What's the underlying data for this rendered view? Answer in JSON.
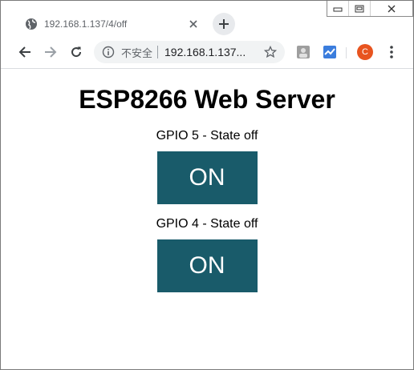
{
  "browser": {
    "tab_title": "192.168.1.137/4/off",
    "address_security": "不安全",
    "address_url": "192.168.1.137/4/off",
    "address_url_display": "192.168.1.137...",
    "avatar_letter": "C",
    "icons": {
      "tab": "globe-icon",
      "tab_close": "close-icon",
      "new_tab": "plus-icon",
      "back": "arrow-left-icon",
      "forward": "arrow-right-icon",
      "reload": "reload-icon",
      "info": "info-icon",
      "bookmark": "star-icon",
      "extension1": "puzzle-extension-icon",
      "extension2": "chart-extension-icon",
      "menu": "more-vert-icon",
      "window_minimize": "minimize-icon",
      "window_restore": "restore-icon",
      "window_close": "window-close-icon"
    }
  },
  "page": {
    "heading": "ESP8266 Web Server",
    "gpios": [
      {
        "state_text": "GPIO 5 - State off",
        "button_label": "ON"
      },
      {
        "state_text": "GPIO 4 - State off",
        "button_label": "ON"
      }
    ]
  },
  "colors": {
    "button_bg": "#195b6a",
    "button_text": "#ffffff",
    "avatar_bg": "#e8541f"
  }
}
